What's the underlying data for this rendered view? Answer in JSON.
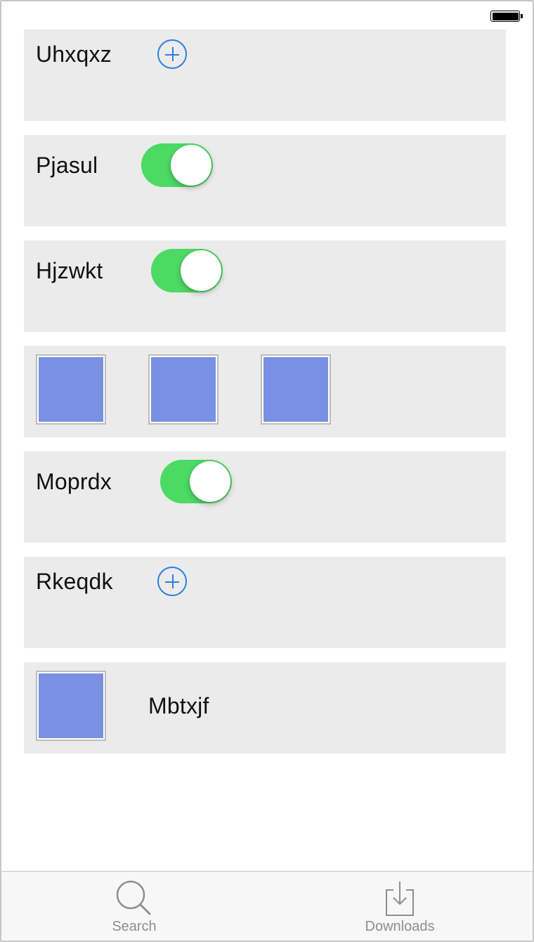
{
  "status_bar": {
    "battery_icon": "battery-full-icon"
  },
  "rows": [
    {
      "type": "label-add",
      "label": "Uhxqxz",
      "icon": "plus-circle-icon"
    },
    {
      "type": "label-toggle",
      "label": "Pjasul",
      "toggle_on": true
    },
    {
      "type": "label-toggle",
      "label": "Hjzwkt",
      "toggle_on": true
    },
    {
      "type": "thumbnails",
      "count": 3
    },
    {
      "type": "label-toggle",
      "label": "Moprdx",
      "toggle_on": true
    },
    {
      "type": "label-add",
      "label": "Rkeqdk",
      "icon": "plus-circle-icon"
    },
    {
      "type": "thumb-label",
      "label": "Mbtxjf"
    }
  ],
  "colors": {
    "accent": "#2a7fe0",
    "toggle_on": "#4cd964",
    "cell_bg": "#ebebeb",
    "thumb": "#7990e3"
  },
  "tabbar": {
    "tabs": [
      {
        "label": "Search",
        "icon": "magnifier-icon"
      },
      {
        "label": "Downloads",
        "icon": "download-tray-icon"
      }
    ]
  }
}
